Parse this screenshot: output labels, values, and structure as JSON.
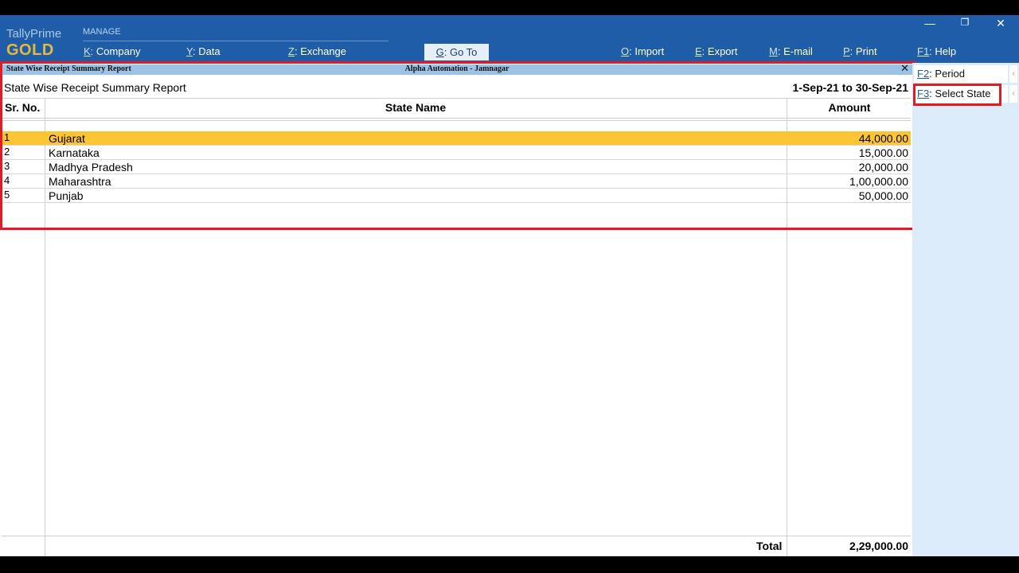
{
  "app": {
    "brand_line1": "TallyPrime",
    "brand_line2": "GOLD",
    "manage_label": "MANAGE"
  },
  "menu": [
    {
      "key": "K",
      "label": "Company"
    },
    {
      "key": "Y",
      "label": "Data"
    },
    {
      "key": "Z",
      "label": "Exchange"
    },
    {
      "key": "O",
      "label": "Import"
    },
    {
      "key": "E",
      "label": "Export"
    },
    {
      "key": "M",
      "label": "E-mail"
    },
    {
      "key": "P",
      "label": "Print"
    },
    {
      "key": "F1",
      "label": "Help"
    }
  ],
  "goto": {
    "key": "G",
    "label": "Go To"
  },
  "window": {
    "report_name": "State Wise Receipt Summary Report",
    "company": "Alpha Automation - Jamnagar"
  },
  "report": {
    "title": "State Wise Receipt Summary Report",
    "period": "1-Sep-21 to 30-Sep-21",
    "columns": {
      "sr": "Sr. No.",
      "state": "State Name",
      "amount": "Amount"
    },
    "rows": [
      {
        "no": "1",
        "state": "Gujarat",
        "amount": "44,000.00"
      },
      {
        "no": "2",
        "state": "Karnataka",
        "amount": "15,000.00"
      },
      {
        "no": "3",
        "state": "Madhya Pradesh",
        "amount": "20,000.00"
      },
      {
        "no": "4",
        "state": "Maharashtra",
        "amount": "1,00,000.00"
      },
      {
        "no": "5",
        "state": "Punjab",
        "amount": "50,000.00"
      }
    ],
    "total_label": "Total",
    "total_value": "2,29,000.00"
  },
  "side_buttons": [
    {
      "key": "F2",
      "label": "Period"
    },
    {
      "key": "F3",
      "label": "Select State"
    }
  ],
  "colors": {
    "topbar": "#1f5da8",
    "selection": "#fdc534",
    "highlight": "#e11b22",
    "gold": "#e7b840"
  }
}
